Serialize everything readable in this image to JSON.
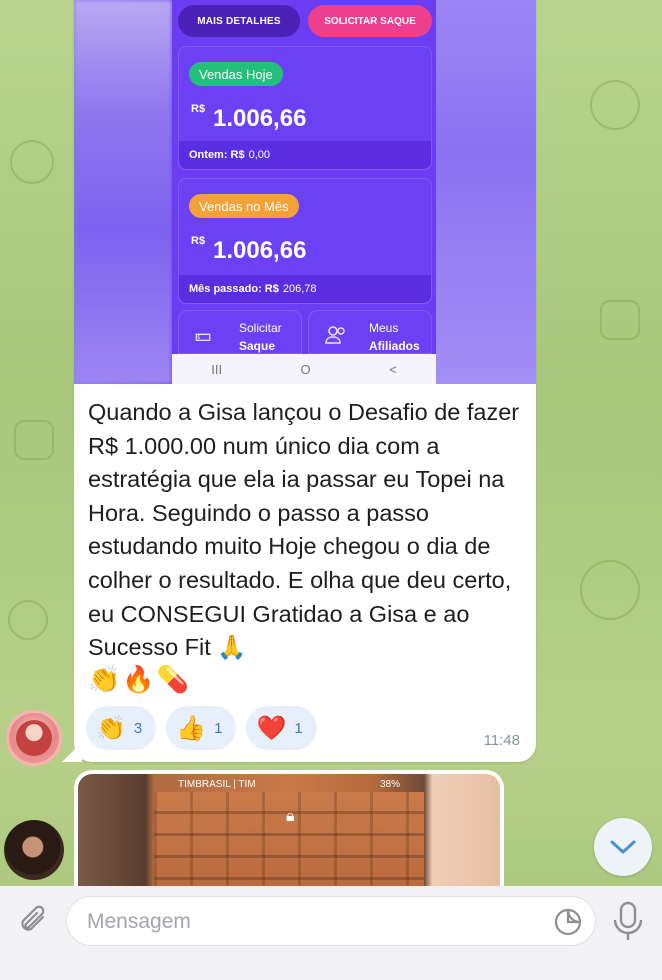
{
  "screenshot_in_message": {
    "mais_detalhes": "MAIS DETALHES",
    "solicitar_saque": "SOLICITAR SAQUE",
    "vendas_hoje": {
      "badge": "Vendas Hoje",
      "currency": "R$",
      "amount": "1.006,66",
      "footer_label": "Ontem: R$",
      "footer_value": "0,00",
      "badge_color": "#22c07a"
    },
    "vendas_mes": {
      "badge": "Vendas no Mês",
      "currency": "R$",
      "amount": "1.006,66",
      "footer_label": "Mês passado: R$",
      "footer_value": "206,78",
      "badge_color": "#f4a13a"
    },
    "tile_saque": {
      "line1": "Solicitar",
      "line2": "Saque",
      "icon": "money-stack-icon"
    },
    "tile_afiliados": {
      "line1": "Meus",
      "line2": "Afiliados",
      "icon": "users-icon"
    },
    "navbar": {
      "recent": "III",
      "home": "O",
      "back": "<"
    }
  },
  "message1": {
    "text": "Quando a Gisa lançou o Desafio de fazer R$ 1.000.00 num único dia com a estratégia que ela ia passar eu Topei na Hora. Seguindo o passo a passo estudando muito Hoje chegou o dia de colher o resultado. E olha que deu certo, eu CONSEGUI Gratidao a Gisa e ao Sucesso Fit 🙏",
    "emojis": "👏🔥💊",
    "reactions": [
      {
        "emoji": "👏",
        "count": "3"
      },
      {
        "emoji": "👍",
        "count": "1"
      },
      {
        "emoji": "❤️",
        "count": "1"
      }
    ],
    "time": "11:48"
  },
  "message2": {
    "status_carrier": "TIMBRASIL | TIM",
    "status_battery": "38%"
  },
  "input": {
    "placeholder": "Mensagem"
  },
  "colors": {
    "accent": "#6a3df2",
    "pink": "#ee3f8e",
    "reaction_text": "#3a78c9"
  }
}
